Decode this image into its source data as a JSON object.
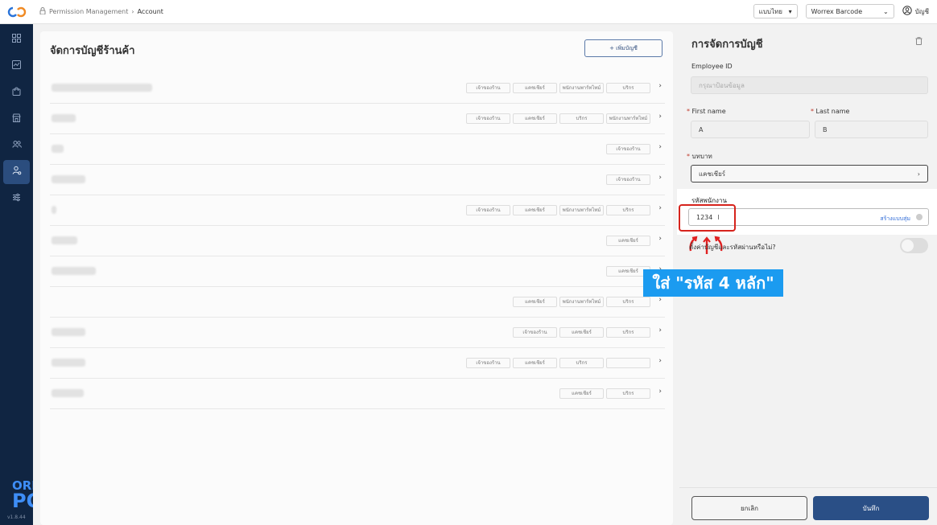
{
  "topbar": {
    "breadcrumb_parent": "Permission Management",
    "breadcrumb_current": "Account",
    "language": "แบบไทย",
    "store": "Worrex Barcode",
    "account_label": "บัญชี"
  },
  "sidebar": {
    "brand_top": "ORDER",
    "brand_bottom": "POS",
    "version": "v1.8.44"
  },
  "main": {
    "title": "จัดการบัญชีร้านค้า",
    "add_button": "+ เพิ่มบัญชี",
    "rows": [
      {
        "tags": [
          "เจ้าของร้าน",
          "แคชเชียร์",
          "พนักงานพาร์ทไทม์",
          "บริกร"
        ]
      },
      {
        "tags": [
          "เจ้าของร้าน",
          "แคชเชียร์",
          "บริกร",
          "พนักงานพาร์ทไทม์"
        ]
      },
      {
        "tags": [
          "เจ้าของร้าน"
        ]
      },
      {
        "tags": [
          "เจ้าของร้าน"
        ]
      },
      {
        "tags": [
          "เจ้าของร้าน",
          "แคชเชียร์",
          "พนักงานพาร์ทไทม์",
          "บริกร"
        ]
      },
      {
        "tags": [
          "แคชเชียร์"
        ]
      },
      {
        "tags": [
          "แคชเชียร์"
        ]
      },
      {
        "tags": [
          "แคชเชียร์",
          "พนักงานพาร์ทไทม์",
          "บริกร"
        ]
      },
      {
        "tags": [
          "เจ้าของร้าน",
          "แคชเชียร์",
          "บริกร"
        ]
      },
      {
        "tags": [
          "เจ้าของร้าน",
          "แคชเชียร์",
          "บริกร",
          ""
        ]
      },
      {
        "tags": [
          "แคชเชียร์",
          "บริกร"
        ]
      }
    ]
  },
  "panel": {
    "title": "การจัดการบัญชี",
    "employee_id_label": "Employee ID",
    "employee_id_placeholder": "กรุณาป้อนข้อมูล",
    "first_name_label": "First name",
    "first_name_value": "A",
    "last_name_label": "Last name",
    "last_name_value": "B",
    "role_label": "บทบาท",
    "role_value": "แคชเชียร์",
    "pin_label": "รหัสพนักงาน",
    "pin_value": "1234",
    "pin_generate": "สร้างแบบสุ่ม",
    "toggle_label": "ตั้งค่าบัญชีและรหัสผ่านหรือไม่?",
    "cancel_button": "ยกเลิก",
    "save_button": "บันทึก"
  },
  "annotation": {
    "callout": "ใส่ \"รหัส 4 หลัก\""
  },
  "colors": {
    "sidebar_bg": "#102542",
    "primary": "#2a4f86",
    "callout_bg": "#1b9bf0",
    "highlight_red": "#d6231c"
  }
}
